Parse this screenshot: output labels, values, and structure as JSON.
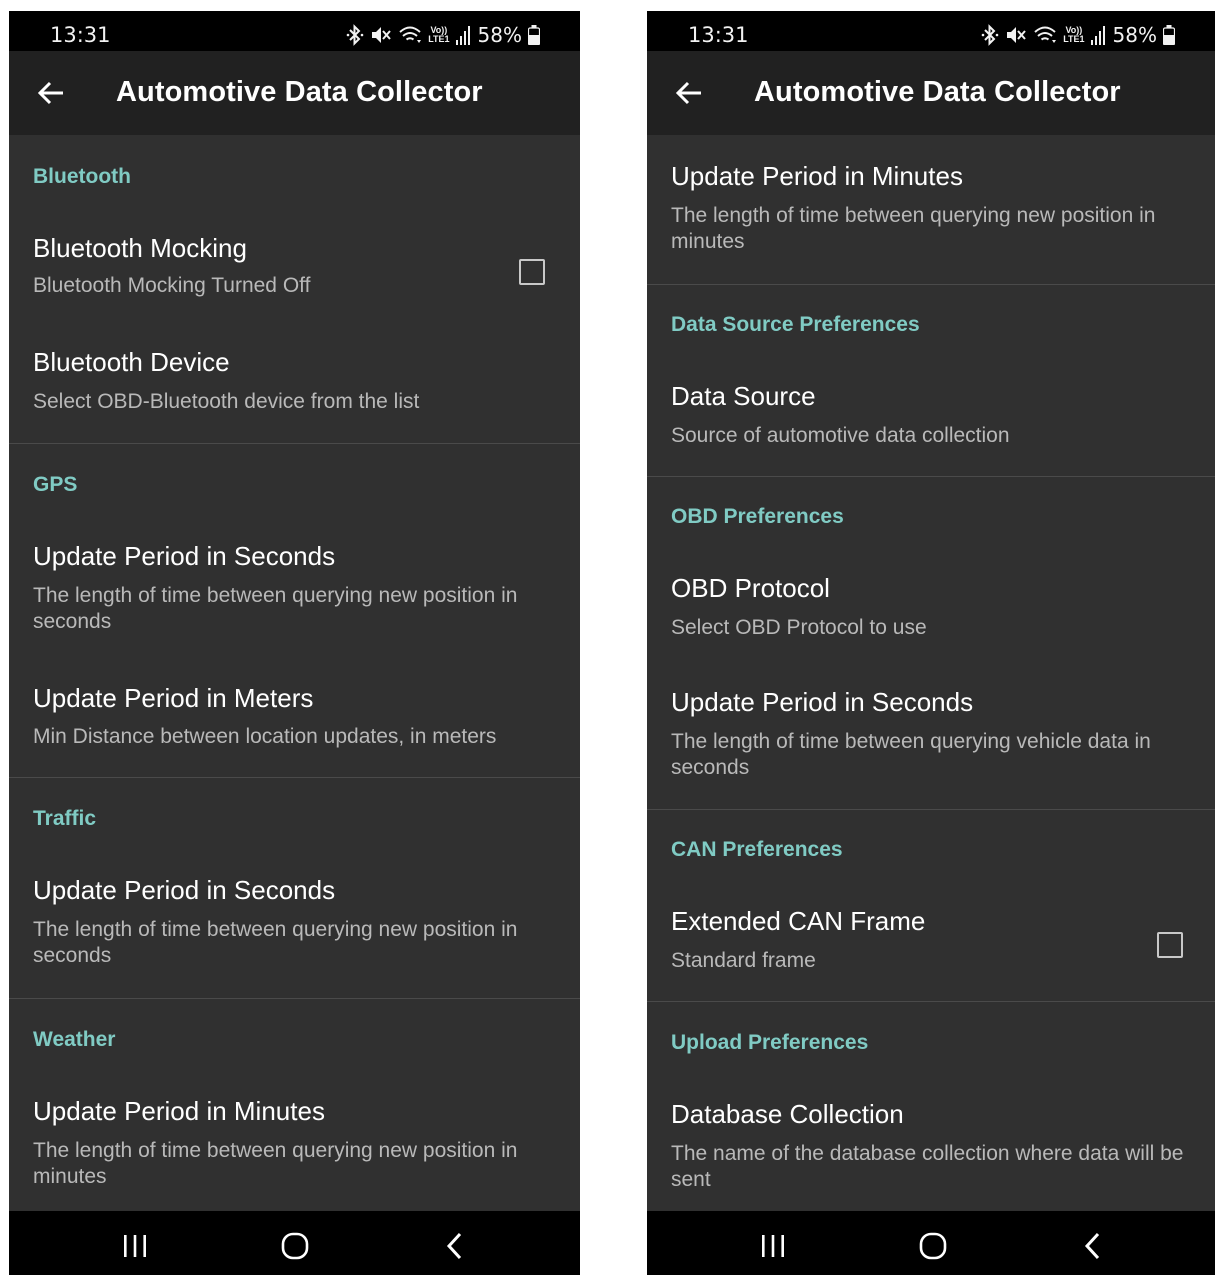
{
  "status": {
    "time": "13:31",
    "lte_top": "Vo))",
    "lte_bottom": "LTE1",
    "battery": "58%"
  },
  "app": {
    "title": "Automotive Data Collector"
  },
  "left": {
    "bluetooth_header": "Bluetooth",
    "bt_mocking_title": "Bluetooth Mocking",
    "bt_mocking_summary": "Bluetooth Mocking Turned Off",
    "bt_device_title": "Bluetooth Device",
    "bt_device_summary": "Select OBD-Bluetooth device from the list",
    "gps_header": "GPS",
    "gps_seconds_title": "Update Period in Seconds",
    "gps_seconds_summary": "The length of time between querying new position in seconds",
    "gps_meters_title": "Update Period in Meters",
    "gps_meters_summary": "Min Distance between location updates, in meters",
    "traffic_header": "Traffic",
    "traffic_seconds_title": "Update Period in Seconds",
    "traffic_seconds_summary": "The length of time between querying new position in seconds",
    "weather_header": "Weather",
    "weather_minutes_title": "Update Period in Minutes",
    "weather_minutes_summary": "The length of time between querying new position in minutes"
  },
  "right": {
    "minutes_title": "Update Period in Minutes",
    "minutes_summary": "The length of time between querying new position in minutes",
    "data_source_header": "Data Source Preferences",
    "data_source_title": "Data Source",
    "data_source_summary": "Source of automotive data collection",
    "obd_header": "OBD Preferences",
    "obd_protocol_title": "OBD Protocol",
    "obd_protocol_summary": "Select OBD Protocol to use",
    "obd_seconds_title": "Update Period in Seconds",
    "obd_seconds_summary": "The length of time between querying vehicle data in seconds",
    "can_header": "CAN Preferences",
    "can_frame_title": "Extended CAN Frame",
    "can_frame_summary": "Standard frame",
    "upload_header": "Upload Preferences",
    "db_collection_title": "Database Collection",
    "db_collection_summary": "The name of the database collection where data will be sent"
  },
  "colors": {
    "accent": "#80cbc4",
    "background": "#303030",
    "app_bar": "#212121"
  },
  "icons": [
    "bluetooth-icon",
    "mute-icon",
    "wifi-icon",
    "signal-icon",
    "battery-icon",
    "back-arrow-icon",
    "recents-icon",
    "home-icon",
    "nav-back-icon"
  ]
}
